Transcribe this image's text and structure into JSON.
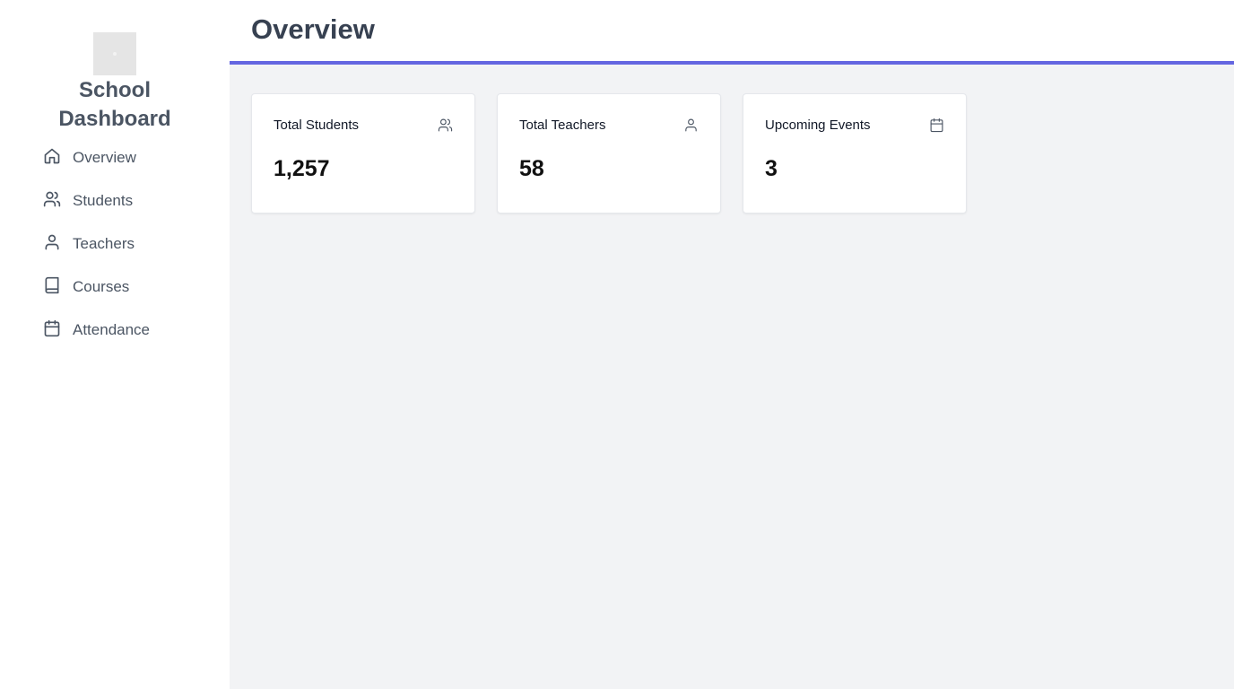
{
  "sidebar": {
    "brand_line1": "School",
    "brand_line2": "Dashboard",
    "items": [
      {
        "label": "Overview",
        "icon": "home-icon"
      },
      {
        "label": "Students",
        "icon": "users-icon"
      },
      {
        "label": "Teachers",
        "icon": "user-icon"
      },
      {
        "label": "Courses",
        "icon": "book-icon"
      },
      {
        "label": "Attendance",
        "icon": "calendar-icon"
      }
    ]
  },
  "header": {
    "title": "Overview",
    "accent_color": "#6466e1"
  },
  "cards": [
    {
      "label": "Total Students",
      "value": "1,257",
      "icon": "users-icon"
    },
    {
      "label": "Total Teachers",
      "value": "58",
      "icon": "user-icon"
    },
    {
      "label": "Upcoming Events",
      "value": "3",
      "icon": "calendar-icon"
    }
  ]
}
